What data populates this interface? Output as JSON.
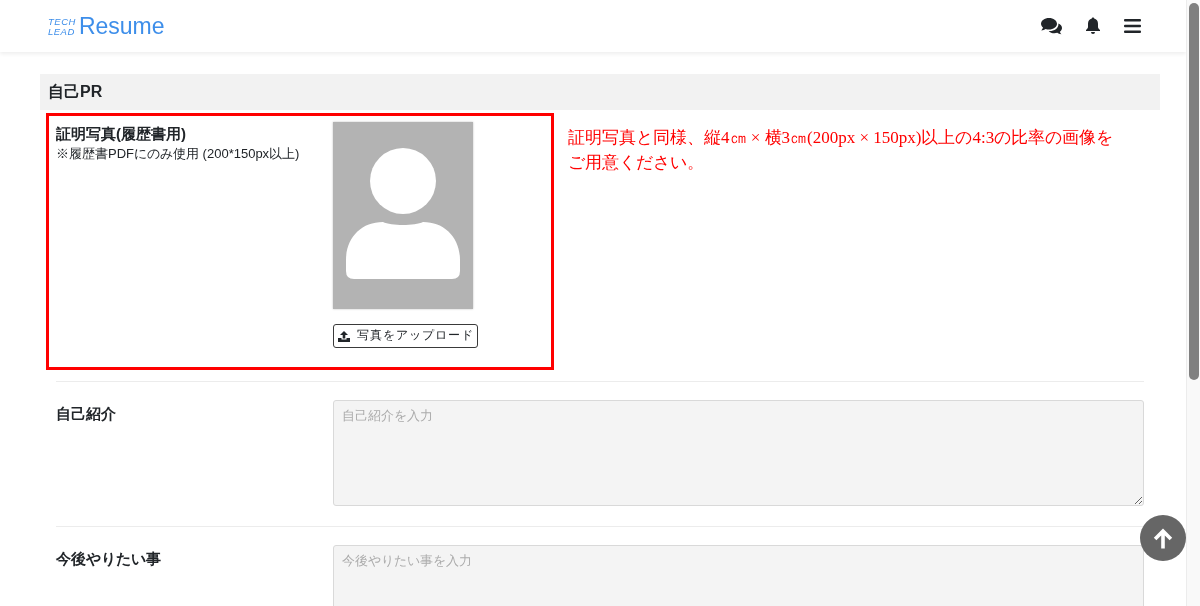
{
  "header": {
    "logo": {
      "tagline": [
        "TECH",
        "LEAD"
      ],
      "name": "Resume"
    }
  },
  "section": {
    "title": "自己PR"
  },
  "photo_field": {
    "label": "証明写真(履歴書用)",
    "note": "※履歴書PDFにのみ使用 (200*150px以上)",
    "button": "写真をアップロード",
    "highlighted": true
  },
  "annotation": {
    "text": "証明写真と同様、縦4㎝ × 横3㎝(200px × 150px)以上の4:3の比率の画像をご用意ください。"
  },
  "fields": [
    {
      "label": "自己紹介",
      "placeholder": "自己紹介を入力"
    },
    {
      "label": "今後やりたい事",
      "placeholder": "今後やりたい事を入力"
    }
  ]
}
